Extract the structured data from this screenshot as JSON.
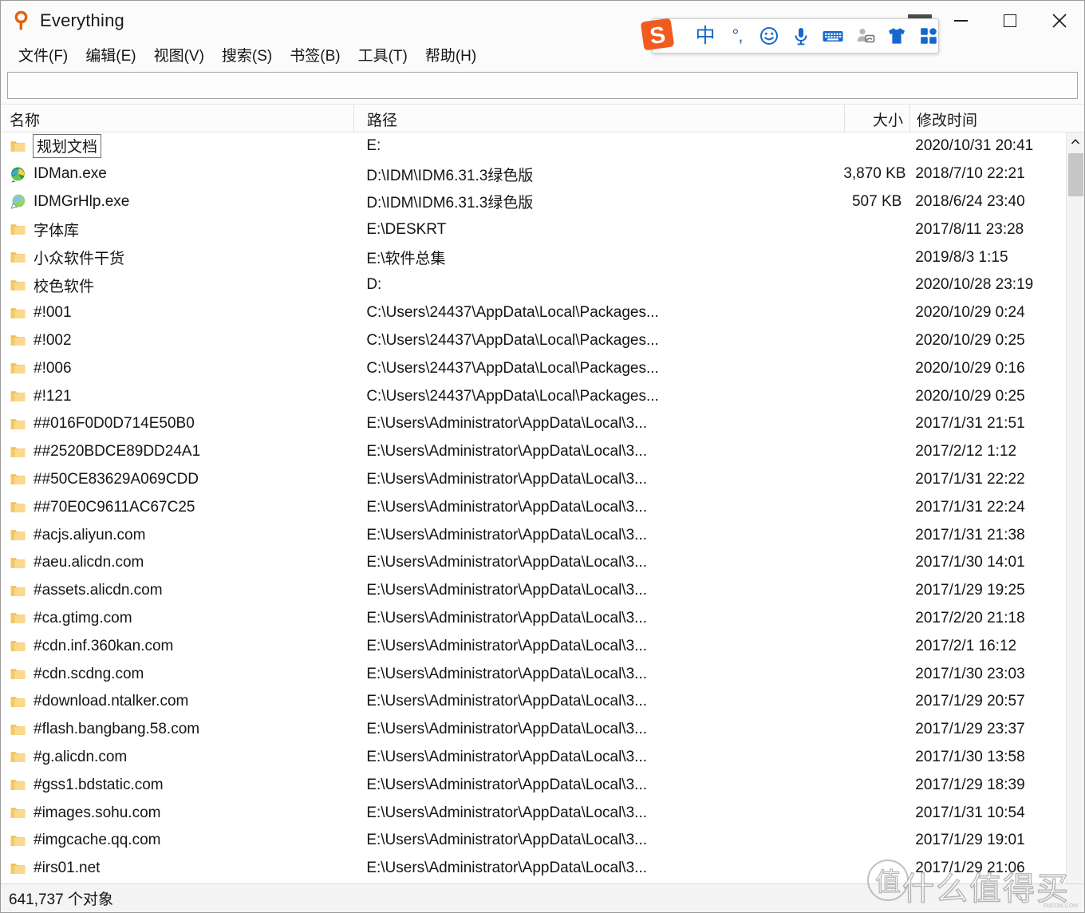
{
  "window": {
    "title": "Everything",
    "app_icon": "magnifier-icon",
    "controls": {
      "minimize": "minimize-button",
      "maximize": "maximize-button",
      "close": "close-button"
    }
  },
  "menu": [
    {
      "label": "文件(F)",
      "name": "menu-file"
    },
    {
      "label": "编辑(E)",
      "name": "menu-edit"
    },
    {
      "label": "视图(V)",
      "name": "menu-view"
    },
    {
      "label": "搜索(S)",
      "name": "menu-search"
    },
    {
      "label": "书签(B)",
      "name": "menu-bookmark"
    },
    {
      "label": "工具(T)",
      "name": "menu-tools"
    },
    {
      "label": "帮助(H)",
      "name": "menu-help"
    }
  ],
  "search": {
    "value": "",
    "placeholder": ""
  },
  "columns": {
    "name": "名称",
    "path": "路径",
    "size": "大小",
    "date": "修改时间"
  },
  "rows": [
    {
      "icon": "folder-icon",
      "name": "规划文档",
      "focused": true,
      "path": "E:",
      "size": "",
      "date": "2020/10/31 20:41"
    },
    {
      "icon": "idman-icon",
      "name": "IDMan.exe",
      "focused": false,
      "path": "D:\\IDM\\IDM6.31.3绿色版",
      "size": "3,870 KB",
      "date": "2018/7/10 22:21"
    },
    {
      "icon": "idmgrhlp-icon",
      "name": "IDMGrHlp.exe",
      "focused": false,
      "path": "D:\\IDM\\IDM6.31.3绿色版",
      "size": "507 KB",
      "date": "2018/6/24 23:40"
    },
    {
      "icon": "folder-icon",
      "name": "字体库",
      "focused": false,
      "path": "E:\\DESKRT",
      "size": "",
      "date": "2017/8/11 23:28"
    },
    {
      "icon": "folder-icon",
      "name": "小众软件干货",
      "focused": false,
      "path": "E:\\软件总集",
      "size": "",
      "date": "2019/8/3 1:15"
    },
    {
      "icon": "folder-icon",
      "name": "校色软件",
      "focused": false,
      "path": "D:",
      "size": "",
      "date": "2020/10/28 23:19"
    },
    {
      "icon": "folder-icon",
      "name": "#!001",
      "focused": false,
      "path": "C:\\Users\\24437\\AppData\\Local\\Packages...",
      "size": "",
      "date": "2020/10/29 0:24"
    },
    {
      "icon": "folder-icon",
      "name": "#!002",
      "focused": false,
      "path": "C:\\Users\\24437\\AppData\\Local\\Packages...",
      "size": "",
      "date": "2020/10/29 0:25"
    },
    {
      "icon": "folder-icon",
      "name": "#!006",
      "focused": false,
      "path": "C:\\Users\\24437\\AppData\\Local\\Packages...",
      "size": "",
      "date": "2020/10/29 0:16"
    },
    {
      "icon": "folder-icon",
      "name": "#!121",
      "focused": false,
      "path": "C:\\Users\\24437\\AppData\\Local\\Packages...",
      "size": "",
      "date": "2020/10/29 0:25"
    },
    {
      "icon": "folder-icon",
      "name": "##016F0D0D714E50B0",
      "focused": false,
      "path": "E:\\Users\\Administrator\\AppData\\Local\\3...",
      "size": "",
      "date": "2017/1/31 21:51"
    },
    {
      "icon": "folder-icon",
      "name": "##2520BDCE89DD24A1",
      "focused": false,
      "path": "E:\\Users\\Administrator\\AppData\\Local\\3...",
      "size": "",
      "date": "2017/2/12 1:12"
    },
    {
      "icon": "folder-icon",
      "name": "##50CE83629A069CDD",
      "focused": false,
      "path": "E:\\Users\\Administrator\\AppData\\Local\\3...",
      "size": "",
      "date": "2017/1/31 22:22"
    },
    {
      "icon": "folder-icon",
      "name": "##70E0C9611AC67C25",
      "focused": false,
      "path": "E:\\Users\\Administrator\\AppData\\Local\\3...",
      "size": "",
      "date": "2017/1/31 22:24"
    },
    {
      "icon": "folder-icon",
      "name": "#acjs.aliyun.com",
      "focused": false,
      "path": "E:\\Users\\Administrator\\AppData\\Local\\3...",
      "size": "",
      "date": "2017/1/31 21:38"
    },
    {
      "icon": "folder-icon",
      "name": "#aeu.alicdn.com",
      "focused": false,
      "path": "E:\\Users\\Administrator\\AppData\\Local\\3...",
      "size": "",
      "date": "2017/1/30 14:01"
    },
    {
      "icon": "folder-icon",
      "name": "#assets.alicdn.com",
      "focused": false,
      "path": "E:\\Users\\Administrator\\AppData\\Local\\3...",
      "size": "",
      "date": "2017/1/29 19:25"
    },
    {
      "icon": "folder-icon",
      "name": "#ca.gtimg.com",
      "focused": false,
      "path": "E:\\Users\\Administrator\\AppData\\Local\\3...",
      "size": "",
      "date": "2017/2/20 21:18"
    },
    {
      "icon": "folder-icon",
      "name": "#cdn.inf.360kan.com",
      "focused": false,
      "path": "E:\\Users\\Administrator\\AppData\\Local\\3...",
      "size": "",
      "date": "2017/2/1 16:12"
    },
    {
      "icon": "folder-icon",
      "name": "#cdn.scdng.com",
      "focused": false,
      "path": "E:\\Users\\Administrator\\AppData\\Local\\3...",
      "size": "",
      "date": "2017/1/30 23:03"
    },
    {
      "icon": "folder-icon",
      "name": "#download.ntalker.com",
      "focused": false,
      "path": "E:\\Users\\Administrator\\AppData\\Local\\3...",
      "size": "",
      "date": "2017/1/29 20:57"
    },
    {
      "icon": "folder-icon",
      "name": "#flash.bangbang.58.com",
      "focused": false,
      "path": "E:\\Users\\Administrator\\AppData\\Local\\3...",
      "size": "",
      "date": "2017/1/29 23:37"
    },
    {
      "icon": "folder-icon",
      "name": "#g.alicdn.com",
      "focused": false,
      "path": "E:\\Users\\Administrator\\AppData\\Local\\3...",
      "size": "",
      "date": "2017/1/30 13:58"
    },
    {
      "icon": "folder-icon",
      "name": "#gss1.bdstatic.com",
      "focused": false,
      "path": "E:\\Users\\Administrator\\AppData\\Local\\3...",
      "size": "",
      "date": "2017/1/29 18:39"
    },
    {
      "icon": "folder-icon",
      "name": "#images.sohu.com",
      "focused": false,
      "path": "E:\\Users\\Administrator\\AppData\\Local\\3...",
      "size": "",
      "date": "2017/1/31 10:54"
    },
    {
      "icon": "folder-icon",
      "name": "#imgcache.qq.com",
      "focused": false,
      "path": "E:\\Users\\Administrator\\AppData\\Local\\3...",
      "size": "",
      "date": "2017/1/29 19:01"
    },
    {
      "icon": "folder-icon",
      "name": "#irs01.net",
      "focused": false,
      "path": "E:\\Users\\Administrator\\AppData\\Local\\3...",
      "size": "",
      "date": "2017/1/29 21:06"
    }
  ],
  "scrollbar": {
    "up_arrow": "chevron-up-icon",
    "thumb": "scrollbar-thumb"
  },
  "statusbar": {
    "text": "641,737 个对象"
  },
  "ime": {
    "logo": "sogou-logo-icon",
    "items": [
      {
        "name": "ime-chinese-mode",
        "label": "中",
        "type": "text"
      },
      {
        "name": "ime-punctuation-mode",
        "label": "°,",
        "type": "text"
      },
      {
        "name": "ime-emoji",
        "label": "",
        "type": "smiley-icon"
      },
      {
        "name": "ime-voice-input",
        "label": "",
        "type": "microphone-icon"
      },
      {
        "name": "ime-soft-keyboard",
        "label": "",
        "type": "keyboard-icon"
      },
      {
        "name": "ime-handwriting",
        "label": "",
        "type": "handwriting-icon"
      },
      {
        "name": "ime-skin",
        "label": "",
        "type": "tshirt-icon"
      },
      {
        "name": "ime-toolbox",
        "label": "",
        "type": "grid-icon"
      }
    ]
  },
  "watermark": {
    "mark": "值",
    "text": "什么值得买",
    "sub": "SMZDM.COM"
  },
  "colors": {
    "accent": "#1568cc",
    "folder": "#f5c969",
    "sogou_orange": "#f25b1f",
    "text": "#151515"
  }
}
